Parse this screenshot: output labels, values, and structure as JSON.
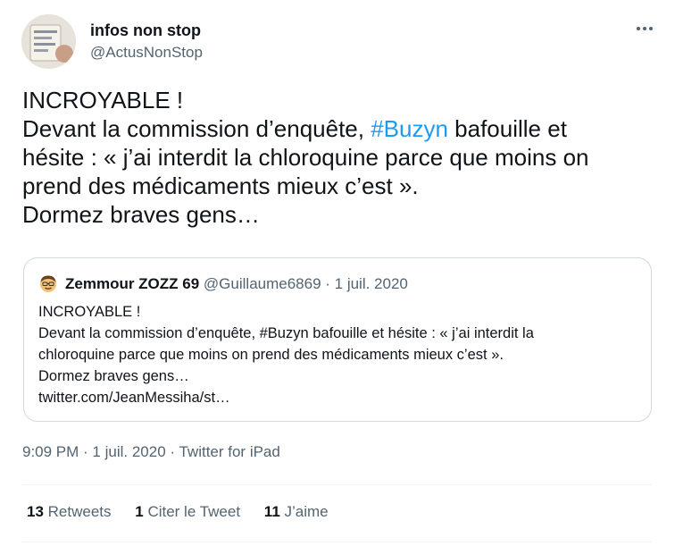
{
  "author": {
    "name": "infos non stop",
    "handle": "@ActusNonStop"
  },
  "tweet": {
    "line1": "INCROYABLE !",
    "line2_pre": "Devant la commission d’enquête, ",
    "hashtag": "#Buzyn",
    "line2_post": " bafouille et",
    "line3": "hésite : « j’ai interdit la chloroquine parce que moins on",
    "line4": "prend des médicaments mieux c’est ».",
    "line5": "Dormez braves gens…"
  },
  "quote": {
    "name": "Zemmour ZOZZ 69",
    "handle": "@Guillaume6869",
    "separator": " · ",
    "date": "1 juil. 2020",
    "line1": "INCROYABLE !",
    "line2": "Devant la commission d’enquête, #Buzyn bafouille et hésite : « j’ai interdit la",
    "line3": "chloroquine parce que moins on prend des médicaments mieux c’est ».",
    "line4": "Dormez braves gens…",
    "link": "twitter.com/JeanMessiha/st…"
  },
  "meta": {
    "time": "9:09 PM",
    "separator": " · ",
    "date": "1 juil. 2020",
    "source": "Twitter for iPad"
  },
  "stats": {
    "retweets_count": "13",
    "retweets_label": " Retweets",
    "quotes_count": "1",
    "quotes_label": " Citer le Tweet",
    "likes_count": "11",
    "likes_label": " J’aime"
  },
  "icons": {
    "more": "more-horizontal-icon",
    "quote_avatar": "emoji-man-icon"
  },
  "colors": {
    "link": "#1d9bf0",
    "secondary": "#536471",
    "border": "#cfd9de"
  }
}
